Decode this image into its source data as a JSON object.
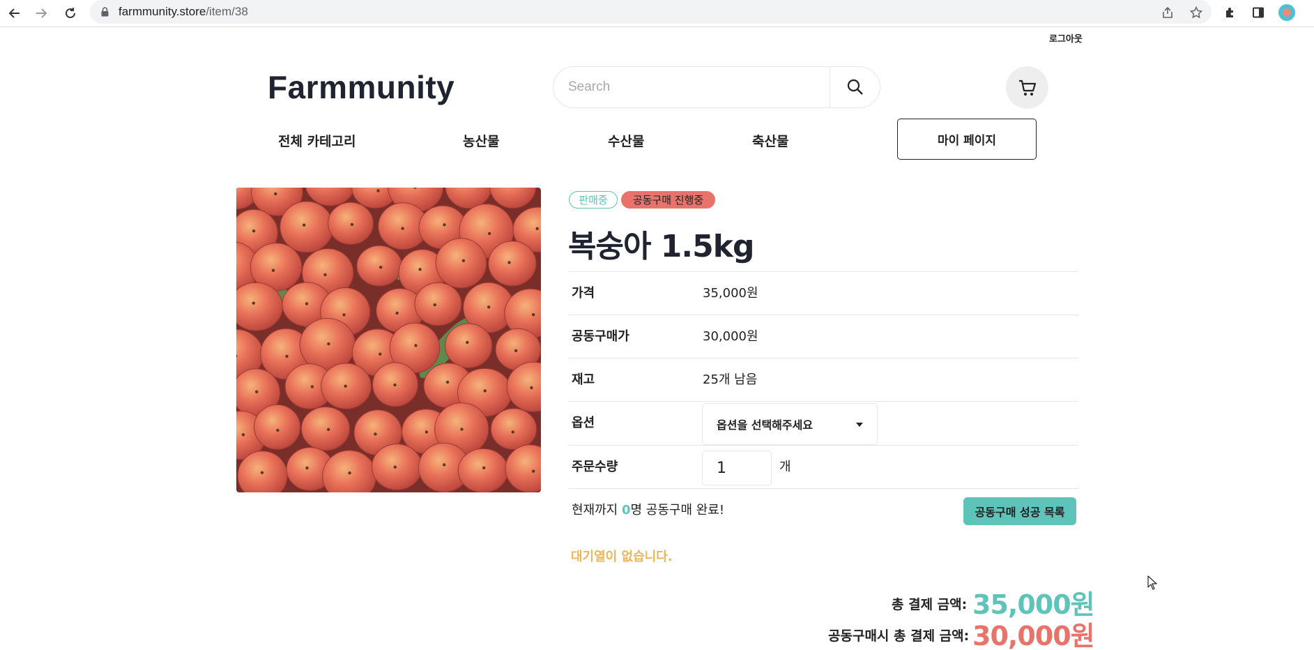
{
  "browser": {
    "url_domain": "farmmunity.store",
    "url_path": "/item/38"
  },
  "header": {
    "logout": "로그아웃",
    "logo": "Farmmunity",
    "search_placeholder": "Search"
  },
  "nav": {
    "items": [
      {
        "label": "전체 카테고리"
      },
      {
        "label": "농산물"
      },
      {
        "label": "수산물"
      },
      {
        "label": "축산물"
      }
    ],
    "mypage": "마이 페이지"
  },
  "product": {
    "badges": {
      "sale": "판매중",
      "group": "공동구매 진행중"
    },
    "title": "복숭아 1.5kg",
    "rows": {
      "price": {
        "label": "가격",
        "value": "35,000원"
      },
      "group_price": {
        "label": "공동구매가",
        "value": "30,000원"
      },
      "stock": {
        "label": "재고",
        "value": "25개 남음"
      },
      "option": {
        "label": "옵션",
        "value": "옵션을 선택해주세요"
      },
      "quantity": {
        "label": "주문수량",
        "value": "1",
        "unit": "개"
      }
    },
    "group_status": {
      "prefix": "현재까지 ",
      "count": "0",
      "suffix": "명 공동구매 완료!",
      "button": "공동구매 성공 목록"
    },
    "waitlist": "대기열이 없습니다.",
    "totals": {
      "normal_label": "총 결제 금액:",
      "normal_value": "35,000원",
      "group_label": "공동구매시 총 결제 금액:",
      "group_value": "30,000원"
    }
  },
  "colors": {
    "accent_teal": "#5ec4b9",
    "accent_red": "#e8736b",
    "accent_yellow": "#e8b75a"
  }
}
